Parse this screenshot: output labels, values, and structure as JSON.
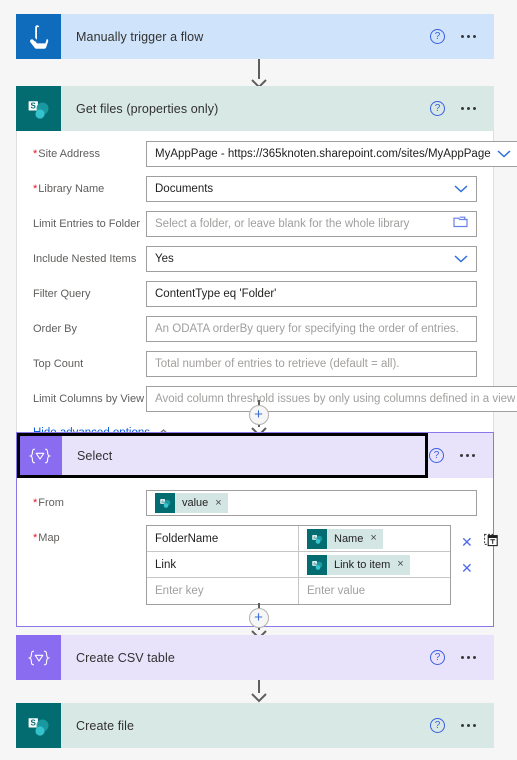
{
  "flow": {
    "nodes": [
      {
        "id": "trigger",
        "title": "Manually trigger a flow",
        "icon": "manual-trigger-icon",
        "help_label": "?",
        "more_label": "More commands"
      },
      {
        "id": "get-files",
        "title": "Get files (properties only)",
        "icon": "sharepoint-icon",
        "help_label": "?",
        "more_label": "More commands",
        "fields": [
          {
            "label": "Site Address",
            "required": true,
            "value": "MyAppPage - https://365knoten.sharepoint.com/sites/MyAppPage",
            "placeholder": "",
            "control": "dropdown"
          },
          {
            "label": "Library Name",
            "required": true,
            "value": "Documents",
            "placeholder": "",
            "control": "dropdown"
          },
          {
            "label": "Limit Entries to Folder",
            "required": false,
            "value": "",
            "placeholder": "Select a folder, or leave blank for the whole library",
            "control": "folder-picker"
          },
          {
            "label": "Include Nested Items",
            "required": false,
            "value": "Yes",
            "placeholder": "",
            "control": "dropdown"
          },
          {
            "label": "Filter Query",
            "required": false,
            "value": "ContentType eq 'Folder'",
            "placeholder": "",
            "control": "text"
          },
          {
            "label": "Order By",
            "required": false,
            "value": "",
            "placeholder": "An ODATA orderBy query for specifying the order of entries.",
            "control": "text"
          },
          {
            "label": "Top Count",
            "required": false,
            "value": "",
            "placeholder": "Total number of entries to retrieve (default = all).",
            "control": "text"
          },
          {
            "label": "Limit Columns by View",
            "required": false,
            "value": "",
            "placeholder": "Avoid column threshold issues by only using columns defined in a view",
            "control": "dropdown"
          }
        ],
        "advanced_options_label": "Hide advanced options"
      },
      {
        "id": "select",
        "title": "Select",
        "icon": "data-operation-icon",
        "help_label": "?",
        "more_label": "More commands",
        "selected": true,
        "from": {
          "label": "From",
          "required": true,
          "token": {
            "text": "value",
            "icon": "sharepoint-icon",
            "remove_label": "×"
          }
        },
        "map": {
          "label": "Map",
          "required": true,
          "rows": [
            {
              "key": "FolderName",
              "key_placeholder": "",
              "value_token": {
                "text": "Name",
                "icon": "sharepoint-icon",
                "remove_label": "×"
              },
              "value_placeholder": "",
              "has_delete": true,
              "has_switch_text": true
            },
            {
              "key": "Link",
              "key_placeholder": "",
              "value_token": {
                "text": "Link to item",
                "icon": "sharepoint-icon",
                "remove_label": "×"
              },
              "value_placeholder": "",
              "has_delete": true,
              "has_switch_text": false
            },
            {
              "key": "",
              "key_placeholder": "Enter key",
              "value_token": null,
              "value_placeholder": "Enter value",
              "has_delete": false,
              "has_switch_text": false
            }
          ]
        }
      },
      {
        "id": "create-csv-table",
        "title": "Create CSV table",
        "icon": "data-operation-icon",
        "help_label": "?",
        "more_label": "More commands"
      },
      {
        "id": "create-file",
        "title": "Create file",
        "icon": "sharepoint-icon",
        "help_label": "?",
        "more_label": "More commands"
      }
    ],
    "insert_button_label": "+",
    "colors": {
      "trigger_header": "#cfe4fa",
      "trigger_tile": "#0f6cbd",
      "sharepoint_header": "#d7e8e5",
      "sharepoint_tile": "#036c70",
      "data_op_header": "#e9e2fb",
      "data_op_tile": "#8a6cf1",
      "canvas": "#f6f6f6",
      "link": "#0f60d6",
      "required_star": "#e81123",
      "selection_outline": "#000000",
      "select_card_border": "#8b77e8"
    }
  }
}
